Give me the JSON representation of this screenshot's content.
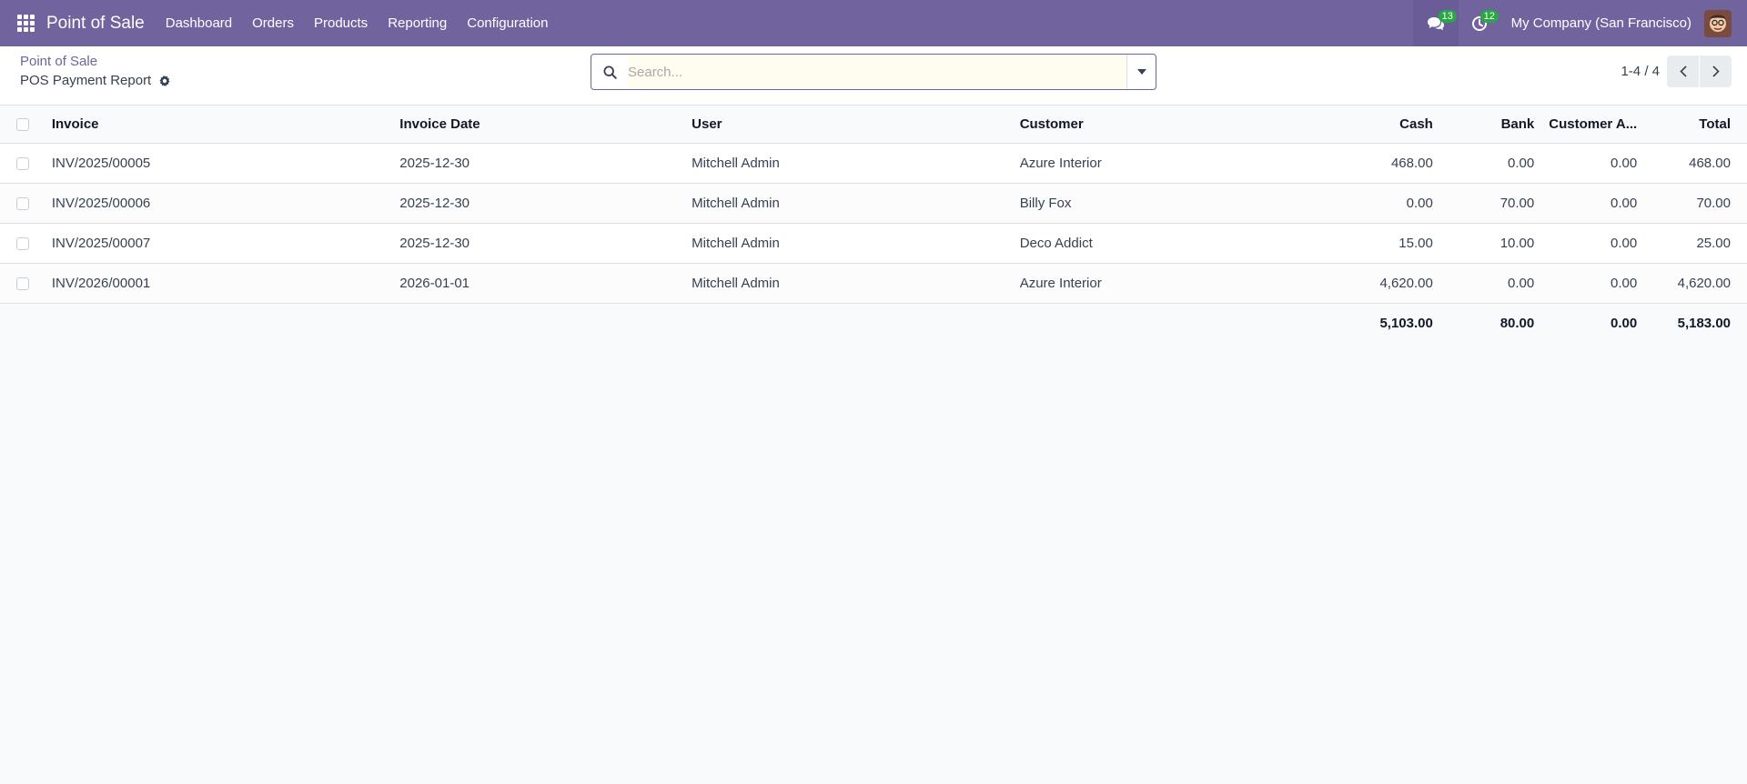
{
  "navbar": {
    "app_name": "Point of Sale",
    "menu": [
      "Dashboard",
      "Orders",
      "Products",
      "Reporting",
      "Configuration"
    ],
    "chat_count": "13",
    "activity_count": "12",
    "company": "My Company (San Francisco)",
    "colors": {
      "bar": "#71639e",
      "badge": "#28a745"
    }
  },
  "control_panel": {
    "breadcrumb_parent": "Point of Sale",
    "page_title": "POS Payment Report",
    "search_placeholder": "Search...",
    "search_value": "",
    "pager": "1-4 / 4"
  },
  "table": {
    "columns": [
      "Invoice",
      "Invoice Date",
      "User",
      "Customer",
      "Cash",
      "Bank",
      "Customer A...",
      "Total"
    ],
    "rows": [
      [
        "INV/2025/00005",
        "2025-12-30",
        "Mitchell Admin",
        "Azure Interior",
        "468.00",
        "0.00",
        "0.00",
        "468.00"
      ],
      [
        "INV/2025/00006",
        "2025-12-30",
        "Mitchell Admin",
        "Billy Fox",
        "0.00",
        "70.00",
        "0.00",
        "70.00"
      ],
      [
        "INV/2025/00007",
        "2025-12-30",
        "Mitchell Admin",
        "Deco Addict",
        "15.00",
        "10.00",
        "0.00",
        "25.00"
      ],
      [
        "INV/2026/00001",
        "2026-01-01",
        "Mitchell Admin",
        "Azure Interior",
        "4,620.00",
        "0.00",
        "0.00",
        "4,620.00"
      ]
    ],
    "totals": {
      "cash": "5,103.00",
      "bank": "80.00",
      "customer_account": "0.00",
      "total": "5,183.00"
    }
  }
}
